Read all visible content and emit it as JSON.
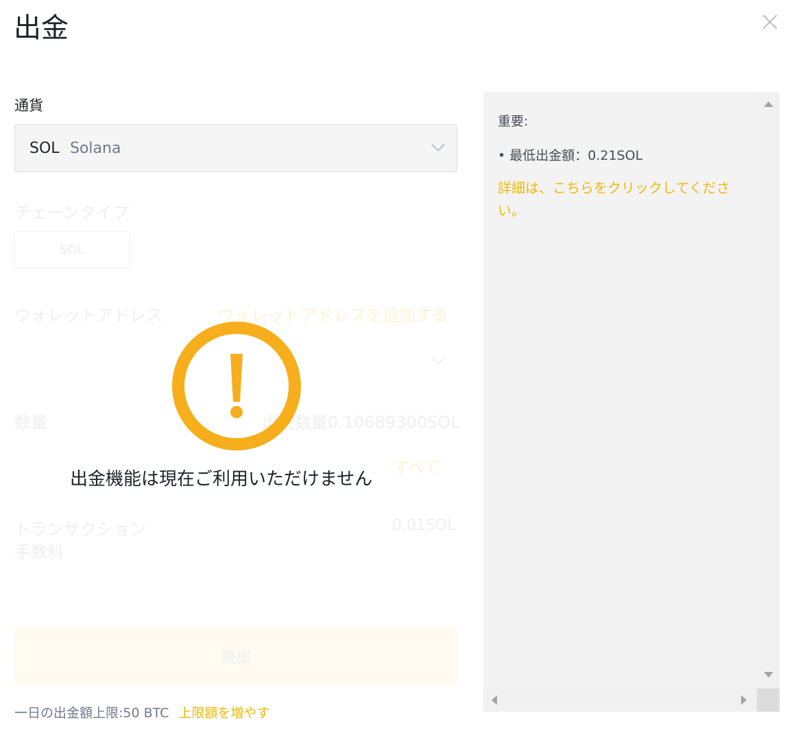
{
  "header": {
    "title": "出金"
  },
  "form": {
    "currency_label": "通貨",
    "currency": {
      "code": "SOL",
      "name": "Solana"
    },
    "chain_label": "チェーンタイプ",
    "chain_option": "SOL",
    "address_label": "ウォレットアドレス",
    "add_address": "ウォレットアドレスを追加する",
    "amount_label": "数量",
    "available": "出金数量0.10689300SOL",
    "all": "すべて",
    "fee_label_line1": "トランザクション",
    "fee_label_line2": "手数料",
    "fee_value": "0.01SOL",
    "submit": "提出",
    "limit_text": "一日の出金額上限:50 BTC",
    "limit_link": "上限額を増やす"
  },
  "overlay": {
    "message": "出金機能は現在ご利用いただけません"
  },
  "notice": {
    "heading": "重要:",
    "min_withdraw": "• 最低出金額：0.21SOL",
    "detail_link": "詳細は、こちらをクリックしてください。"
  },
  "colors": {
    "accent": "#f0b90b",
    "warning": "#f7ae1c"
  }
}
